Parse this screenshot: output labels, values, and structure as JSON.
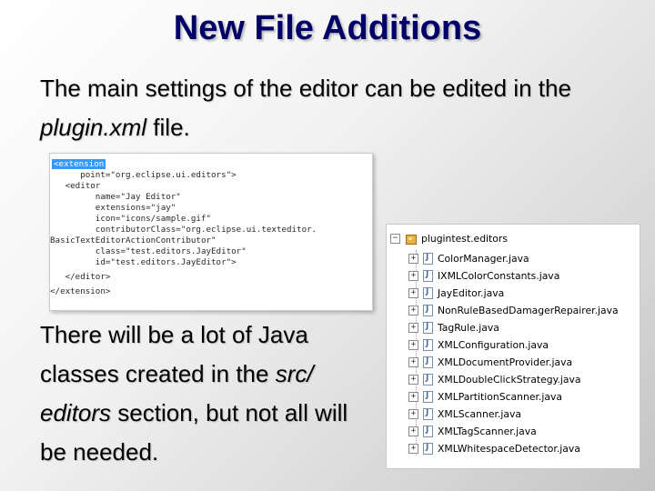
{
  "slide": {
    "title": "New File Additions",
    "para1": {
      "pre": "The main settings of the editor can be edited in the ",
      "em": "plugin.xml",
      "post": " file."
    },
    "para2": {
      "pre": "There will be a lot of Java classes created in the ",
      "em": "src/ editors",
      "post": " section, but not all will be needed."
    }
  },
  "code_snippet": {
    "lines": [
      "<extension",
      "      point=\"org.eclipse.ui.editors\">",
      "   <editor",
      "         name=\"Jay Editor\"",
      "         extensions=\"jay\"",
      "         icon=\"icons/sample.gif\"",
      "         contributorClass=\"org.eclipse.ui.texteditor.",
      "BasicTextEditorActionContributor\"",
      "         class=\"test.editors.JayEditor\"",
      "         id=\"test.editors.JayEditor\">",
      "   </editor>",
      "</extension>"
    ]
  },
  "package_tree": {
    "root": "plugintest.editors",
    "root_expander": "−",
    "item_expander": "+",
    "items": [
      "ColorManager.java",
      "IXMLColorConstants.java",
      "JayEditor.java",
      "NonRuleBasedDamagerRepairer.java",
      "TagRule.java",
      "XMLConfiguration.java",
      "XMLDocumentProvider.java",
      "XMLDoubleClickStrategy.java",
      "XMLPartitionScanner.java",
      "XMLScanner.java",
      "XMLTagScanner.java",
      "XMLWhitespaceDetector.java"
    ]
  },
  "colors": {
    "title": "#000066",
    "selection": "#3399ff"
  },
  "icons": {
    "package": "package-icon",
    "java_file": "java-file-icon"
  }
}
